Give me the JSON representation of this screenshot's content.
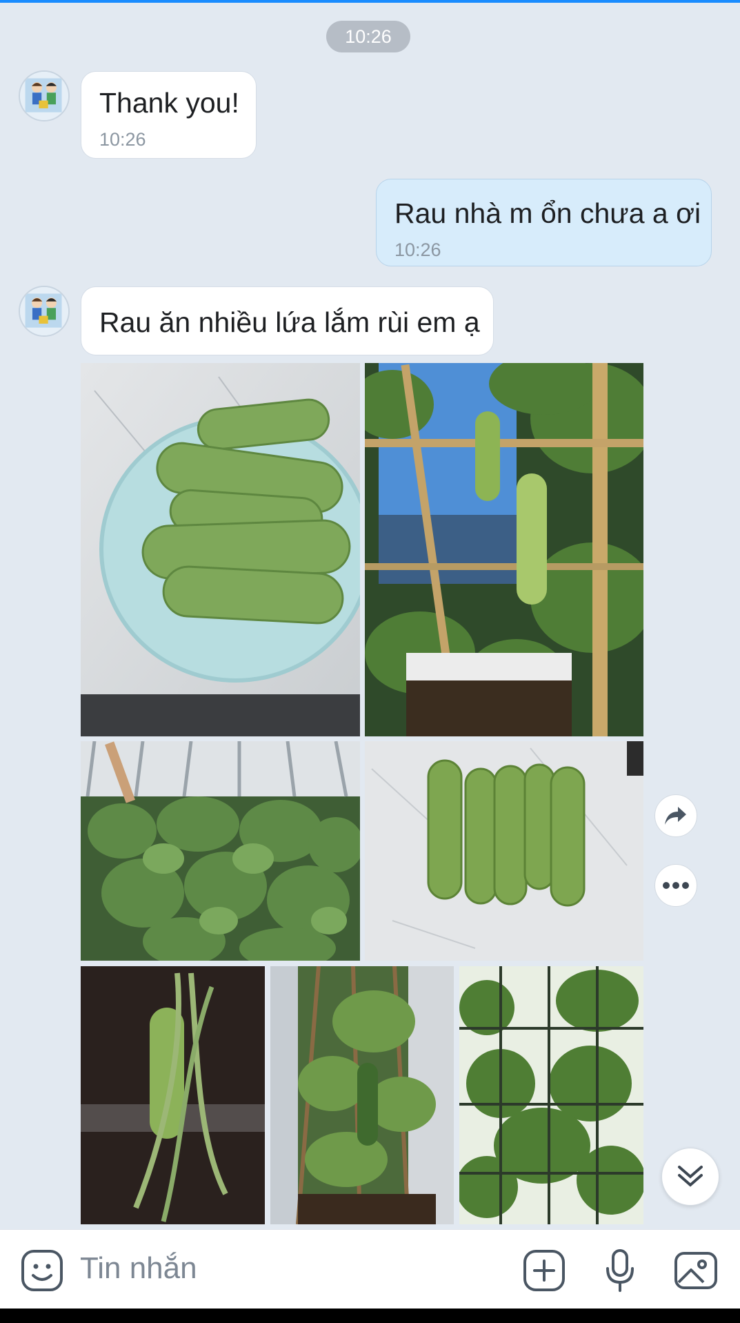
{
  "conversation": {
    "time_separator": "10:26",
    "messages": [
      {
        "direction": "incoming",
        "text": "Thank you!",
        "time": "10:26"
      },
      {
        "direction": "outgoing",
        "text": "Rau nhà m ổn chưa a ơi",
        "time": "10:26"
      },
      {
        "direction": "incoming",
        "text": "Rau ăn nhiều lứa lắm rùi em ạ"
      }
    ],
    "photo_album": {
      "photos": [
        "cucumbers-on-plate",
        "cucumber-hanging-on-bamboo-trellis",
        "leafy-greens-planter",
        "five-cucumbers-on-marble",
        "cucumber-and-long-beans",
        "cucumbers-growing-balcony",
        "green-vine-trellis-wall"
      ]
    }
  },
  "actions": {
    "share_icon": "share-arrow-icon",
    "more_icon": "more-dots-icon",
    "scroll_down_icon": "double-chevron-down-icon"
  },
  "composer": {
    "placeholder": "Tin nhắn",
    "icons": [
      "sticker-icon",
      "add-icon",
      "microphone-icon",
      "image-icon"
    ]
  },
  "colors": {
    "background": "#e2e9f1",
    "incoming_bubble": "#ffffff",
    "outgoing_bubble": "#d7ecfb",
    "accent": "#1a8cff"
  }
}
